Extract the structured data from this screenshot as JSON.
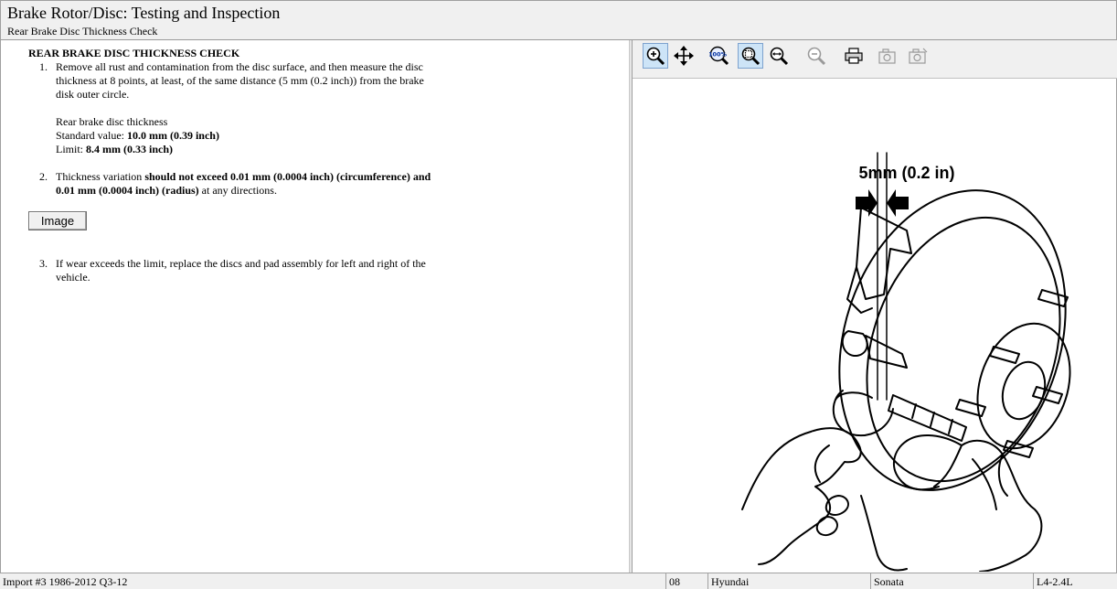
{
  "header": {
    "title": "Brake Rotor/Disc:  Testing and Inspection",
    "subtitle": "Rear Brake Disc Thickness Check"
  },
  "content": {
    "section_title": "REAR BRAKE DISC THICKNESS CHECK",
    "step1": {
      "number": "1.",
      "lines": [
        "Remove all rust and contamination from the disc surface, and then measure the disc",
        "thickness at 8 points, at least, of the same distance (5 mm (0.2 inch)) from the brake",
        "disk outer circle."
      ],
      "spec_heading": "Rear brake disc thickness",
      "standard_label": "Standard value: ",
      "standard_value": "10.0 mm (0.39 inch)",
      "limit_label": "Limit: ",
      "limit_value": "8.4 mm (0.33 inch)"
    },
    "step2": {
      "number": "2.",
      "line1_a": "Thickness variation ",
      "line1_b": "should not exceed 0.01 mm (0.0004 inch) (circumference) and",
      "line2_b": "0.01 mm (0.0004 inch) (radius)",
      "line2_c": " at any directions."
    },
    "image_button_label": "Image",
    "step3": {
      "number": "3.",
      "lines": [
        "If wear exceeds the limit, replace the discs and pad assembly for left and right of the",
        "vehicle."
      ]
    }
  },
  "toolbar": {
    "buttons": [
      {
        "name": "zoom-in-icon",
        "active": true
      },
      {
        "name": "pan-icon",
        "active": false
      },
      {
        "name": "zoom-100-icon",
        "active": false
      },
      {
        "name": "zoom-fit-icon",
        "active": true
      },
      {
        "name": "zoom-width-icon",
        "active": false
      },
      {
        "name": "zoom-out-icon",
        "active": false
      },
      {
        "name": "print-icon",
        "active": false
      },
      {
        "name": "copy-image-icon",
        "active": false
      },
      {
        "name": "copy-image-alt-icon",
        "active": false
      }
    ],
    "zoom_100_glyph": "100%"
  },
  "drawing": {
    "dimension_label": "5mm (0.2 in)"
  },
  "statusbar": {
    "import": "Import #3 1986-2012 Q3-12",
    "year": "08",
    "make": "Hyundai",
    "model": "Sonata",
    "engine": "L4-2.4L"
  }
}
